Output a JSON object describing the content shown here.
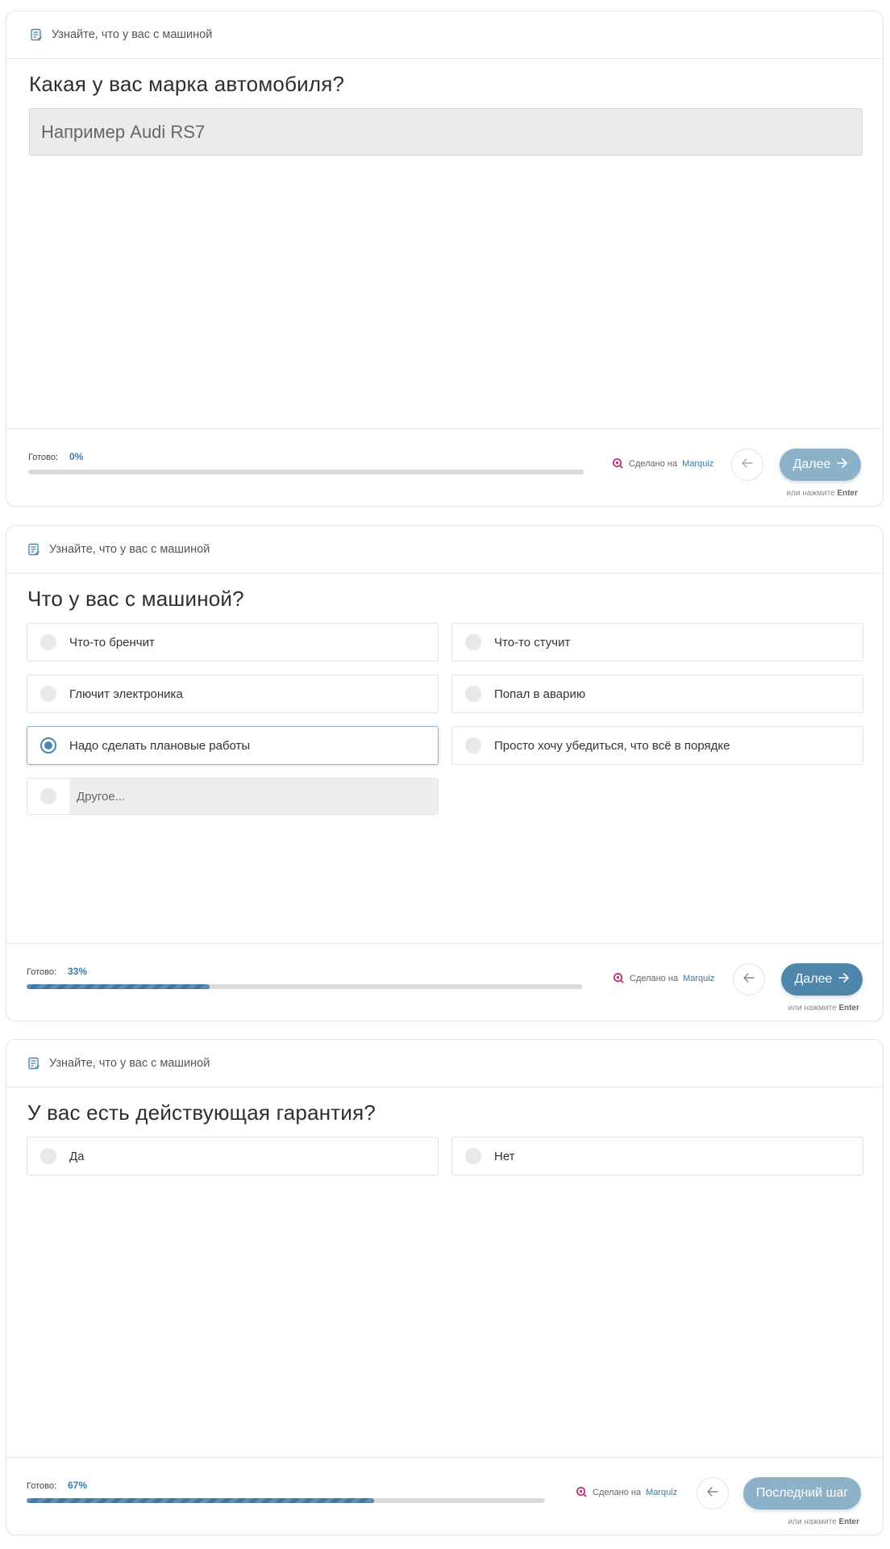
{
  "header_title": "Узнайте, что у вас с машиной",
  "footer": {
    "progress_label": "Готово:",
    "credit_prefix": "Сделано на",
    "credit_brand": "Marquiz",
    "hint_prefix": "или нажмите",
    "hint_key": "Enter"
  },
  "steps": [
    {
      "question": "Какая у вас марка автомобиля?",
      "input_placeholder": "Например Audi RS7",
      "progress_text": "0%",
      "progress_fraction": 0,
      "next_label": "Далее"
    },
    {
      "question": "Что у вас с машиной?",
      "options": [
        "Что-то бренчит",
        "Что-то стучит",
        "Глючит электроника",
        "Попал в аварию",
        "Надо сделать плановые работы",
        "Просто хочу убедиться, что всё в порядке"
      ],
      "selected_option": "Надо сделать плановые работы",
      "other_placeholder": "Другое...",
      "progress_text": "33%",
      "progress_fraction": 0.33,
      "next_label": "Далее"
    },
    {
      "question": "У вас есть действующая гарантия?",
      "options": [
        "Да",
        "Нет"
      ],
      "progress_text": "67%",
      "progress_fraction": 0.67,
      "next_label": "Последний шаг"
    }
  ],
  "colors": {
    "accent": "#4f86ab",
    "accent_light": "#8cb2c9",
    "progress_text": "#3d7aa5",
    "marquiz_icon": "#c2347a"
  }
}
